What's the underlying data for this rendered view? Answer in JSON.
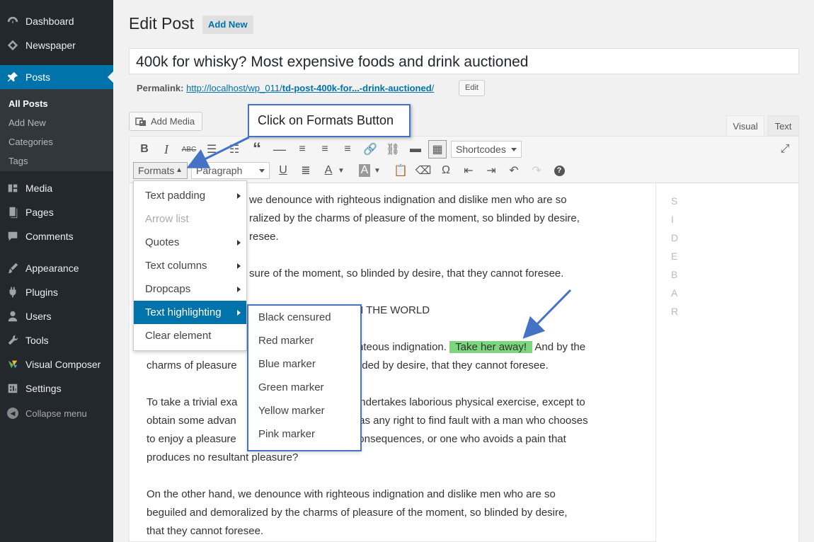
{
  "sidebar": {
    "items": [
      {
        "label": "Dashboard",
        "icon": "dashboard-icon"
      },
      {
        "label": "Newspaper",
        "icon": "newspaper-icon"
      },
      {
        "label": "Posts",
        "icon": "pin-icon"
      },
      {
        "label": "Media",
        "icon": "media-icon"
      },
      {
        "label": "Pages",
        "icon": "pages-icon"
      },
      {
        "label": "Comments",
        "icon": "comments-icon"
      },
      {
        "label": "Appearance",
        "icon": "brush-icon"
      },
      {
        "label": "Plugins",
        "icon": "plugin-icon"
      },
      {
        "label": "Users",
        "icon": "users-icon"
      },
      {
        "label": "Tools",
        "icon": "wrench-icon"
      },
      {
        "label": "Visual Composer",
        "icon": "vc-icon"
      },
      {
        "label": "Settings",
        "icon": "settings-icon"
      }
    ],
    "submenu": [
      "All Posts",
      "Add New",
      "Categories",
      "Tags"
    ],
    "collapse_label": "Collapse menu"
  },
  "header": {
    "title": "Edit Post",
    "add_new": "Add New"
  },
  "post": {
    "title": "400k for whisky? Most expensive foods and drink auctioned",
    "permalink_label": "Permalink:",
    "permalink_url_prefix": "http://localhost/wp_011/",
    "permalink_slug": "td-post-400k-for...-drink-auctioned",
    "permalink_url_suffix": "/",
    "permalink_edit": "Edit"
  },
  "editor": {
    "add_media": "Add Media",
    "tab_visual": "Visual",
    "tab_text": "Text",
    "shortcodes": "Shortcodes",
    "formats": "Formats",
    "paragraph": "Paragraph"
  },
  "formats_menu": {
    "items": [
      "Text padding",
      "Arrow list",
      "Quotes",
      "Text columns",
      "Dropcaps",
      "Text highlighting",
      "Clear element"
    ],
    "highlight_items": [
      "Black censured",
      "Red marker",
      "Blue marker",
      "Green marker",
      "Yellow marker",
      "Pink marker"
    ]
  },
  "content": {
    "p1_line1": "we denounce with righteous indignation and dislike men who are so",
    "p1_line2": "ralized by the charms of pleasure of the moment, so blinded by desire,",
    "p1_line3": "resee.",
    "p2": "sure of the moment, so blinded by desire, that they cannot foresee.",
    "heading": "E IN THE WORLD",
    "p3_part1": "hteous indignation.",
    "p3_highlight": "Take her away!",
    "p3_part2": "And by the",
    "p3_line2_a": "charms of pleasure",
    "p3_line2_b": "inded by desire, that they cannot foresee.",
    "p4_line1_a": "To take a trivial exa",
    "p4_line1_b": "er undertakes laborious physical exercise, except to",
    "p4_line2_a": "obtain some advan",
    "p4_line2_b": "has any right to find fault with a man who chooses",
    "p4_line3_a": "to enjoy a pleasure",
    "p4_line3_b": "consequences, or one who avoids a pain that",
    "p4_line4": "produces no resultant pleasure?",
    "p5_line1": "On the other hand, we denounce with righteous indignation and dislike men who are so",
    "p5_line2": "beguiled and demoralized by the charms of pleasure of the moment, so blinded by desire,",
    "p5_line3": "that they cannot foresee."
  },
  "sidebar_placeholder": [
    "S",
    "I",
    "D",
    "E",
    "B",
    "A",
    "R"
  ],
  "annotation": {
    "callout": "Click on Formats Button"
  },
  "colors": {
    "accent": "#0073aa",
    "admin_bar": "#23282d",
    "highlight_green": "#7cd67c",
    "annotation_blue": "#4472c4"
  }
}
